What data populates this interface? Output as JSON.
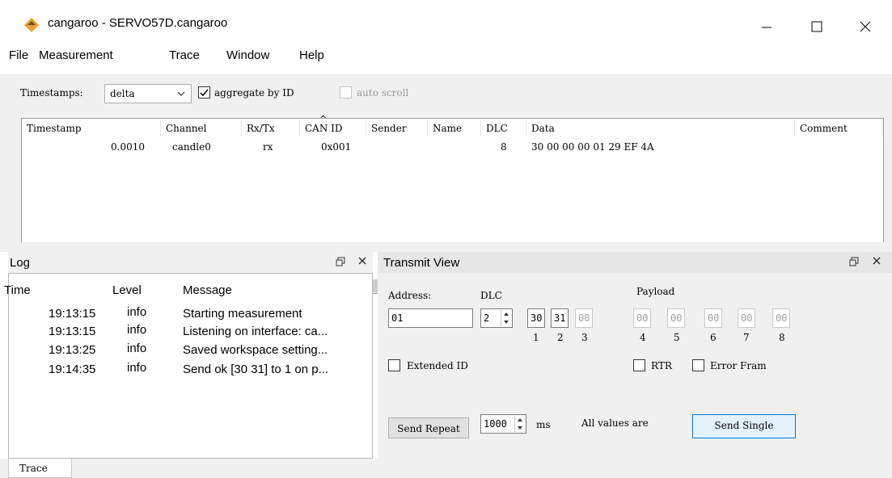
{
  "window": {
    "title": "cangaroo - SERVO57D.cangaroo",
    "controls": {
      "minimize": "—",
      "maximize": "☐",
      "close": "✕"
    }
  },
  "menu": [
    "File",
    "Measurement",
    "Trace",
    "Window",
    "Help"
  ],
  "trace": {
    "timestamps_label": "Timestamps:",
    "timestamps_value": "delta",
    "aggregate_label": "aggregate by ID",
    "aggregate_checked": true,
    "autoscroll_label": "auto scroll",
    "autoscroll_checked": false,
    "columns": [
      "Timestamp",
      "Channel",
      "Rx/Tx",
      "CAN ID",
      "Sender",
      "Name",
      "DLC",
      "Data",
      "Comment"
    ],
    "rows": [
      {
        "timestamp": "0.0010",
        "channel": "candle0",
        "rxtx": "rx",
        "can_id": "0x001",
        "sender": "",
        "name": "",
        "dlc": "8",
        "data": "30 00 00 00 01 29 EF 4A",
        "comment": ""
      }
    ],
    "sort_indicator": "^"
  },
  "log": {
    "title": "Log",
    "columns": [
      "Time",
      "Level",
      "Message"
    ],
    "rows": [
      {
        "time": "19:13:15",
        "level": "info",
        "message": "Starting measurement"
      },
      {
        "time": "19:13:15",
        "level": "info",
        "message": "Listening on interface: ca..."
      },
      {
        "time": "19:13:25",
        "level": "info",
        "message": "Saved workspace setting..."
      },
      {
        "time": "19:14:35",
        "level": "info",
        "message": "Send ok [30 31] to 1 on p..."
      }
    ]
  },
  "transmit": {
    "title": "Transmit View",
    "address_label": "Address:",
    "dlc_label": "DLC",
    "payload_label": "Payload",
    "address_value": "01",
    "dlc_value": "2",
    "payload": [
      "30",
      "31",
      "00",
      "00",
      "00",
      "00",
      "00",
      "00"
    ],
    "payload_indices": [
      "1",
      "2",
      "3",
      "4",
      "5",
      "6",
      "7",
      "8"
    ],
    "extended_id_label": "Extended ID",
    "rtr_label": "RTR",
    "error_frame_label": "Error Fram",
    "send_repeat_label": "Send Repeat",
    "repeat_value": "1000",
    "ms_label": "ms",
    "values_note": "All values are",
    "send_single_label": "Send Single"
  },
  "bottom_tab": "Trace",
  "colors": {
    "logo": "#f0a030",
    "focus": "#0078d7",
    "panel_bg": "#f0f0f0"
  }
}
